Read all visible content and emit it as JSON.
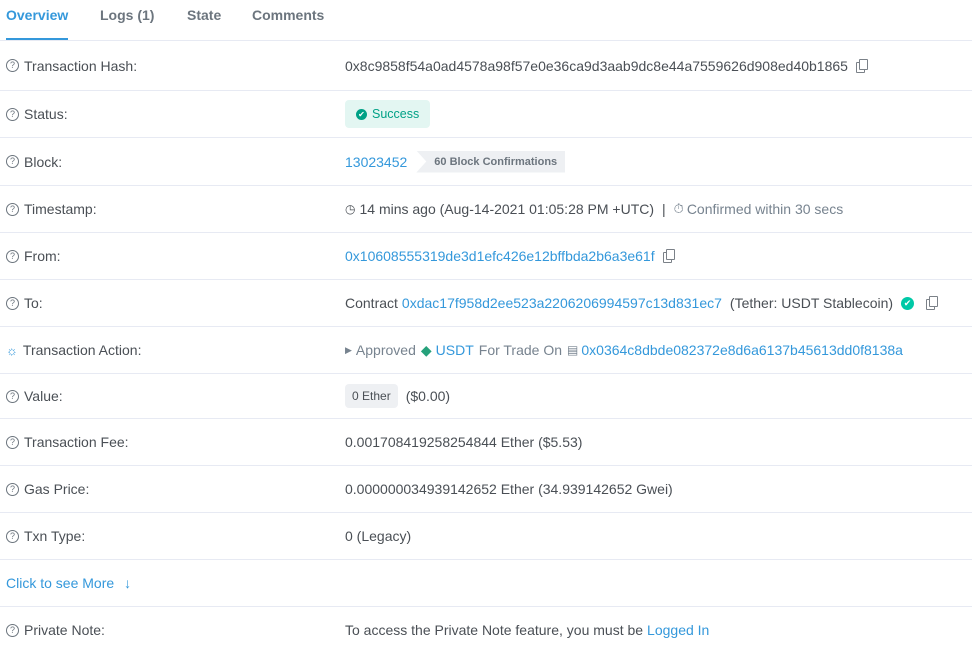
{
  "tabs": [
    {
      "label": "Overview",
      "active": true
    },
    {
      "label": "Logs (1)"
    },
    {
      "label": "State"
    },
    {
      "label": "Comments"
    }
  ],
  "rows": {
    "tx_hash": {
      "label": "Transaction Hash:",
      "value": "0x8c9858f54a0ad4578a98f57e0e36ca9d3aab9dc8e44a7559626d908ed40b1865"
    },
    "status": {
      "label": "Status:",
      "value": "Success"
    },
    "block": {
      "label": "Block:",
      "value": "13023452",
      "confirmations": "60 Block Confirmations"
    },
    "timestamp": {
      "label": "Timestamp:",
      "value": "14 mins ago (Aug-14-2021 01:05:28 PM +UTC)",
      "separator": "|",
      "confirmed": "Confirmed within 30 secs"
    },
    "from": {
      "label": "From:",
      "value": "0x10608555319de3d1efc426e12bffbda2b6a3e61f"
    },
    "to": {
      "label": "To:",
      "prefix": "Contract",
      "value": "0xdac17f958d2ee523a2206206994597c13d831ec7",
      "name": "(Tether: USDT Stablecoin)"
    },
    "action": {
      "label": "Transaction Action:",
      "approved": "Approved",
      "token": "USDT",
      "for_trade": "For Trade On",
      "address": "0x0364c8dbde082372e8d6a6137b45613dd0f8138a"
    },
    "value": {
      "label": "Value:",
      "ether": "0 Ether",
      "usd": "($0.00)"
    },
    "fee": {
      "label": "Transaction Fee:",
      "value": "0.001708419258254844 Ether ($5.53)"
    },
    "gas": {
      "label": "Gas Price:",
      "value": "0.000000034939142652 Ether (34.939142652 Gwei)"
    },
    "txn_type": {
      "label": "Txn Type:",
      "value": "0 (Legacy)"
    },
    "more": {
      "label": "Click to see More"
    },
    "private_note": {
      "label": "Private Note:",
      "value": "To access the Private Note feature, you must be",
      "link": "Logged In"
    }
  },
  "colors": {
    "accent": "#3498db",
    "success": "#00a186",
    "border": "#e7eaf3"
  }
}
